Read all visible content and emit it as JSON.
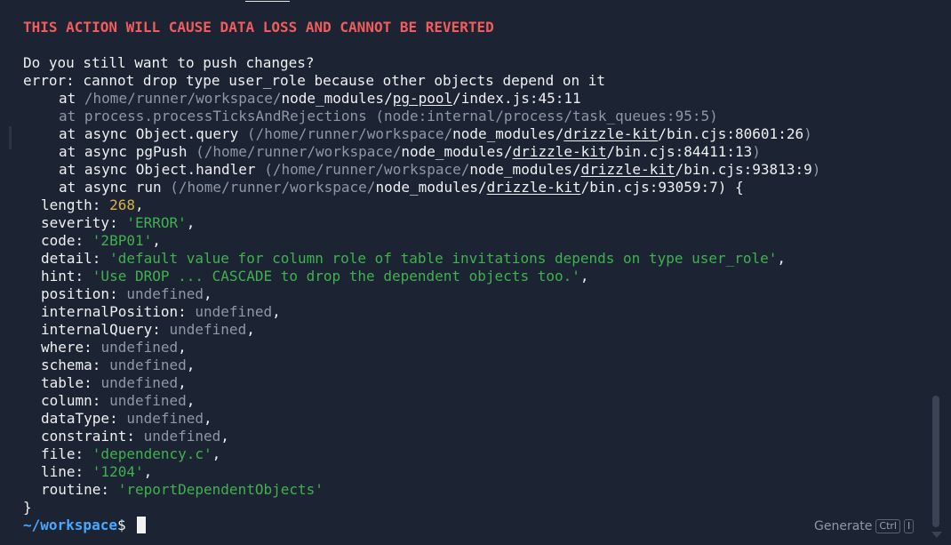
{
  "warning": "THIS ACTION WILL CAUSE DATA LOSS AND CANNOT BE REVERTED",
  "question": "Do you still want to push changes?",
  "error_line": "error: cannot drop type user_role because other objects depend on it",
  "stack": [
    {
      "at": "at ",
      "path_grey": "/home/runner/workspace/",
      "path_white": "node_modules/",
      "pkg": "pg-pool",
      "file": "/index.js:45:11",
      "tail": ""
    },
    {
      "dim": "at process.processTicksAndRejections (node:internal/process/task_queues:95:5)"
    },
    {
      "at": "at async Object.query ",
      "paren_open": "(",
      "path_grey": "/home/runner/workspace/",
      "path_white": "node_modules/",
      "pkg": "drizzle-kit",
      "file": "/bin.cjs:80601:26",
      "tail": ")"
    },
    {
      "at": "at async pgPush ",
      "paren_open": "(",
      "path_grey": "/home/runner/workspace/",
      "path_white": "node_modules/",
      "pkg": "drizzle-kit",
      "file": "/bin.cjs:84411:13",
      "tail": ")"
    },
    {
      "at": "at async Object.handler ",
      "paren_open": "(",
      "path_grey": "/home/runner/workspace/",
      "path_white": "node_modules/",
      "pkg": "drizzle-kit",
      "file": "/bin.cjs:93813:9",
      "tail": ")"
    },
    {
      "at": "at async run ",
      "paren_open": "(",
      "path_grey": "/home/runner/workspace/",
      "path_white": "node_modules/",
      "pkg": "drizzle-kit",
      "file": "/bin.cjs:93059:7",
      "tail": ") {"
    }
  ],
  "fields": [
    {
      "key": "length: ",
      "value": "268",
      "kind": "number"
    },
    {
      "key": "severity: ",
      "value": "'ERROR'",
      "kind": "string"
    },
    {
      "key": "code: ",
      "value": "'2BP01'",
      "kind": "string"
    },
    {
      "key": "detail: ",
      "value": "'default value for column role of table invitations depends on type user_role'",
      "kind": "string"
    },
    {
      "key": "hint: ",
      "value": "'Use DROP ... CASCADE to drop the dependent objects too.'",
      "kind": "string"
    },
    {
      "key": "position: ",
      "value": "undefined",
      "kind": "undef"
    },
    {
      "key": "internalPosition: ",
      "value": "undefined",
      "kind": "undef"
    },
    {
      "key": "internalQuery: ",
      "value": "undefined",
      "kind": "undef"
    },
    {
      "key": "where: ",
      "value": "undefined",
      "kind": "undef"
    },
    {
      "key": "schema: ",
      "value": "undefined",
      "kind": "undef"
    },
    {
      "key": "table: ",
      "value": "undefined",
      "kind": "undef"
    },
    {
      "key": "column: ",
      "value": "undefined",
      "kind": "undef"
    },
    {
      "key": "dataType: ",
      "value": "undefined",
      "kind": "undef"
    },
    {
      "key": "constraint: ",
      "value": "undefined",
      "kind": "undef"
    },
    {
      "key": "file: ",
      "value": "'dependency.c'",
      "kind": "string"
    },
    {
      "key": "line: ",
      "value": "'1204'",
      "kind": "string"
    },
    {
      "key": "routine: ",
      "value": "'reportDependentObjects'",
      "kind": "string",
      "last": true
    }
  ],
  "closing_brace": "}",
  "prompt_path": "~/workspace",
  "prompt_symbol": "$",
  "generate_hint": {
    "label": "Generate",
    "key1": "Ctrl",
    "key2": "I"
  },
  "colors": {
    "background": "#1c2333",
    "warning_red": "#f25c5c",
    "string_green": "#3fb24f",
    "number_yellow": "#d9b244",
    "path_blue": "#4aa8ff",
    "dim_grey": "#8e98a6"
  }
}
